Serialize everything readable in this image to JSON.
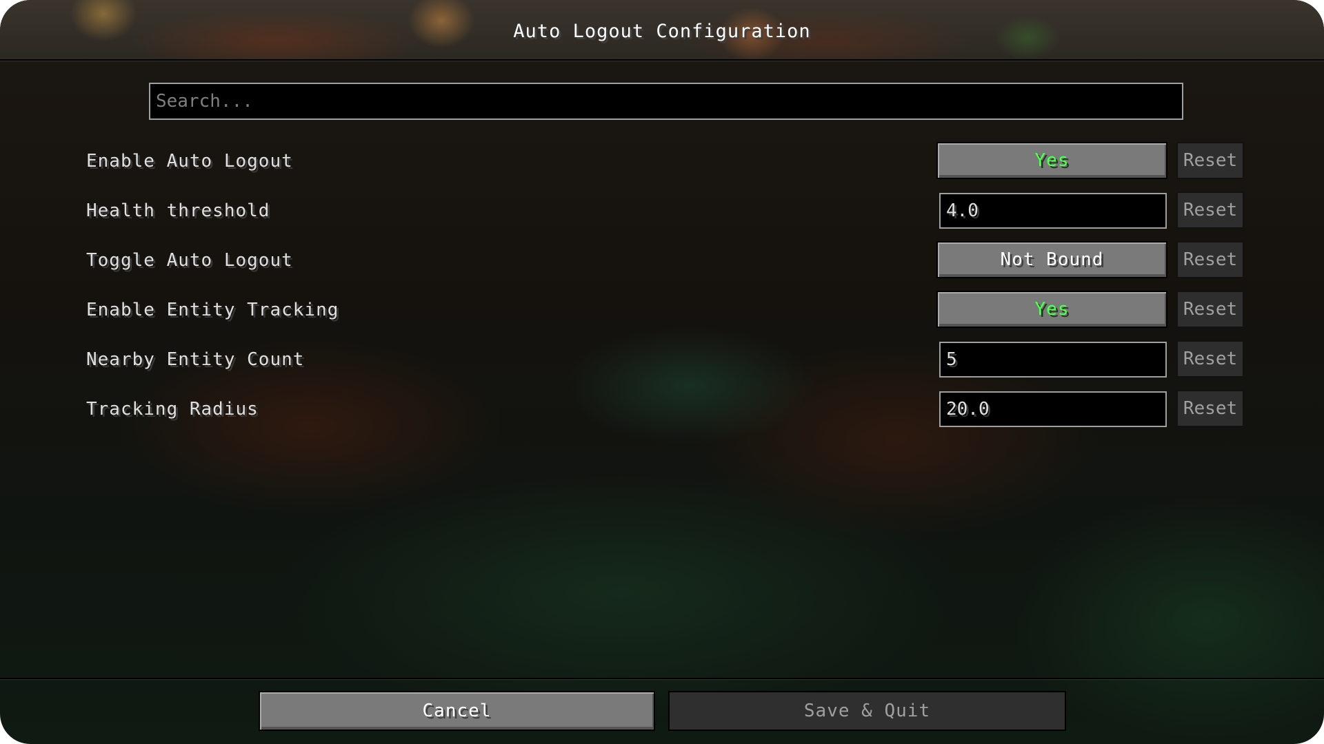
{
  "window": {
    "title": "Auto Logout Configuration"
  },
  "search": {
    "placeholder": "Search...",
    "value": ""
  },
  "options": [
    {
      "label": "Enable Auto Logout",
      "control": "toggle",
      "value": "Yes",
      "value_color": "#55ff55",
      "reset_label": "Reset",
      "reset_enabled": false
    },
    {
      "label": "Health threshold",
      "control": "text",
      "value": "4.0",
      "reset_label": "Reset",
      "reset_enabled": false
    },
    {
      "label": "Toggle Auto Logout",
      "control": "keybind",
      "value": "Not Bound",
      "value_color": "#ffffff",
      "reset_label": "Reset",
      "reset_enabled": false
    },
    {
      "label": "Enable Entity Tracking",
      "control": "toggle",
      "value": "Yes",
      "value_color": "#55ff55",
      "reset_label": "Reset",
      "reset_enabled": false
    },
    {
      "label": "Nearby Entity Count",
      "control": "text",
      "value": "5",
      "reset_label": "Reset",
      "reset_enabled": false
    },
    {
      "label": "Tracking Radius",
      "control": "text",
      "value": "20.0",
      "reset_label": "Reset",
      "reset_enabled": false
    }
  ],
  "footer": {
    "cancel_label": "Cancel",
    "save_label": "Save & Quit",
    "save_enabled": false
  }
}
